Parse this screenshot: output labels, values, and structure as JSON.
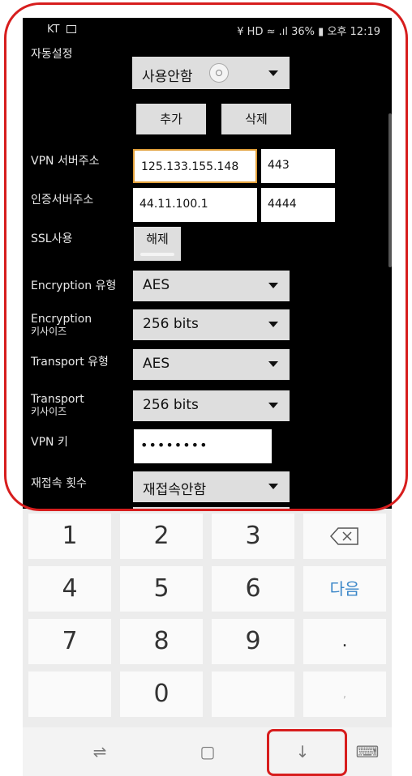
{
  "status_bar": {
    "carrier": "KT",
    "battery": "36%",
    "time": "오후 12:19",
    "signal_text": "¥ HD ≈ .ıl"
  },
  "form": {
    "auto_setting": {
      "label": "자동설정",
      "value": "사용안함"
    },
    "add_button": "추가",
    "delete_button": "삭제",
    "vpn_server": {
      "label": "VPN 서버주소",
      "address": "125.133.155.148",
      "port": "443"
    },
    "auth_server": {
      "label": "인증서버주소",
      "address": "44.11.100.1",
      "port": "4444"
    },
    "ssl": {
      "label": "SSL사용",
      "toggle": "해제"
    },
    "encryption_type": {
      "label": "Encryption 유형",
      "value": "AES"
    },
    "encryption_keysize": {
      "label_line1": "Encryption",
      "label_line2": "키사이즈",
      "value": "256 bits"
    },
    "transport_type": {
      "label": "Transport 유형",
      "value": "AES"
    },
    "transport_keysize": {
      "label_line1": "Transport",
      "label_line2": "키사이즈",
      "value": "256 bits"
    },
    "vpn_key": {
      "label": "VPN 키",
      "value": "••••••••"
    },
    "reconnect": {
      "label": "재접속 횟수",
      "value": "재접속안함"
    }
  },
  "keyboard": {
    "keys": [
      "1",
      "2",
      "3",
      "⌫",
      "4",
      "5",
      "6",
      "다음",
      "7",
      "8",
      "9",
      ".",
      "",
      "0",
      "",
      ""
    ],
    "next_label": "다음"
  },
  "navbar": {
    "recent": "⇌",
    "home": "▢",
    "down": "↓",
    "keyboard": "⌨"
  },
  "accent_colors": {
    "highlight": "#d71d1d",
    "focus": "#e2a03a",
    "next_key": "#3a86c8"
  }
}
